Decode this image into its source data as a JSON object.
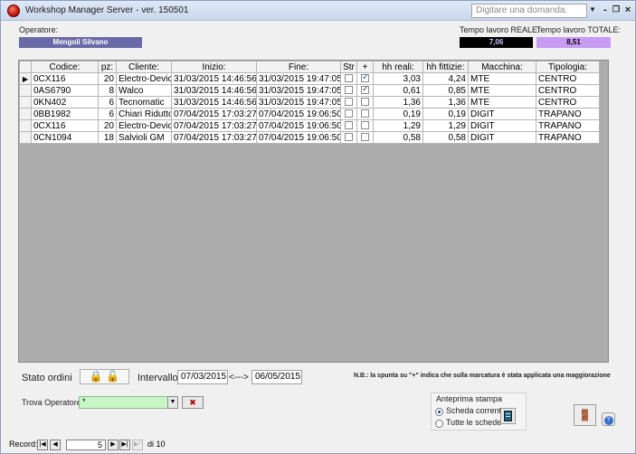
{
  "window": {
    "title": "Workshop Manager Server - ver. 150501",
    "ask_placeholder": "Digitare una domanda."
  },
  "header": {
    "operatore_label": "Operatore:",
    "operatore_value": "Mengoli Silvano",
    "tempo_reale_label": "Tempo lavoro REALE:",
    "tempo_reale_value": "7,06",
    "tempo_totale_label": "Tempo lavoro TOTALE:",
    "tempo_totale_value": "8,51"
  },
  "grid": {
    "columns": [
      "Codice:",
      "pz:",
      "Cliente:",
      "Inizio:",
      "Fine:",
      "Str",
      "+",
      "hh reali:",
      "hh fittizie:",
      "Macchina:",
      "Tipologia:"
    ],
    "rows": [
      {
        "codice": "0CX116",
        "pz": "20",
        "cliente": "Electro-Device",
        "inizio": "31/03/2015 14:46:56",
        "fine": "31/03/2015 19:47:05",
        "str": false,
        "plus": true,
        "hh_reali": "3,03",
        "hh_fittizie": "4,24",
        "macchina": "MTE",
        "tipologia": "CENTRO",
        "current": true
      },
      {
        "codice": "0AS6790",
        "pz": "8",
        "cliente": "Walco",
        "inizio": "31/03/2015 14:46:56",
        "fine": "31/03/2015 19:47:05",
        "str": false,
        "plus": true,
        "hh_reali": "0,61",
        "hh_fittizie": "0,85",
        "macchina": "MTE",
        "tipologia": "CENTRO",
        "current": false
      },
      {
        "codice": "0KN402",
        "pz": "6",
        "cliente": "Tecnomatic",
        "inizio": "31/03/2015 14:46:56",
        "fine": "31/03/2015 19:47:05",
        "str": false,
        "plus": false,
        "hh_reali": "1,36",
        "hh_fittizie": "1,36",
        "macchina": "MTE",
        "tipologia": "CENTRO",
        "current": false
      },
      {
        "codice": "0BB1982",
        "pz": "6",
        "cliente": "Chiari Riduttori",
        "inizio": "07/04/2015 17:03:27",
        "fine": "07/04/2015 19:06:50",
        "str": false,
        "plus": false,
        "hh_reali": "0,19",
        "hh_fittizie": "0,19",
        "macchina": "DIGIT",
        "tipologia": "TRAPANO",
        "current": false
      },
      {
        "codice": "0CX116",
        "pz": "20",
        "cliente": "Electro-Device",
        "inizio": "07/04/2015 17:03:27",
        "fine": "07/04/2015 19:06:50",
        "str": false,
        "plus": false,
        "hh_reali": "1,29",
        "hh_fittizie": "1,29",
        "macchina": "DIGIT",
        "tipologia": "TRAPANO",
        "current": false
      },
      {
        "codice": "0CN1094",
        "pz": "18",
        "cliente": "Salvioli GM",
        "inizio": "07/04/2015 17:03:27",
        "fine": "07/04/2015 19:06:50",
        "str": false,
        "plus": false,
        "hh_reali": "0,58",
        "hh_fittizie": "0,58",
        "macchina": "DIGIT",
        "tipologia": "TRAPANO",
        "current": false
      }
    ]
  },
  "bottom": {
    "stato_label": "Stato ordini",
    "intervallo_label": "Intervallo",
    "date_from": "07/03/2015",
    "date_sep": "<--->",
    "date_to": "06/05/2015",
    "note": "N.B.: la spunta su \"+\" indica che sulla marcatura è stata applicata una maggiorazione",
    "trova_label": "Trova Operatore:",
    "trova_value": "*",
    "anteprima_label": "Anteprima stampa",
    "scheda_corrente": "Scheda corrente",
    "tutte_schede": "Tutte le schede"
  },
  "record_nav": {
    "label": "Record:",
    "current": "5",
    "total": "di 10"
  }
}
